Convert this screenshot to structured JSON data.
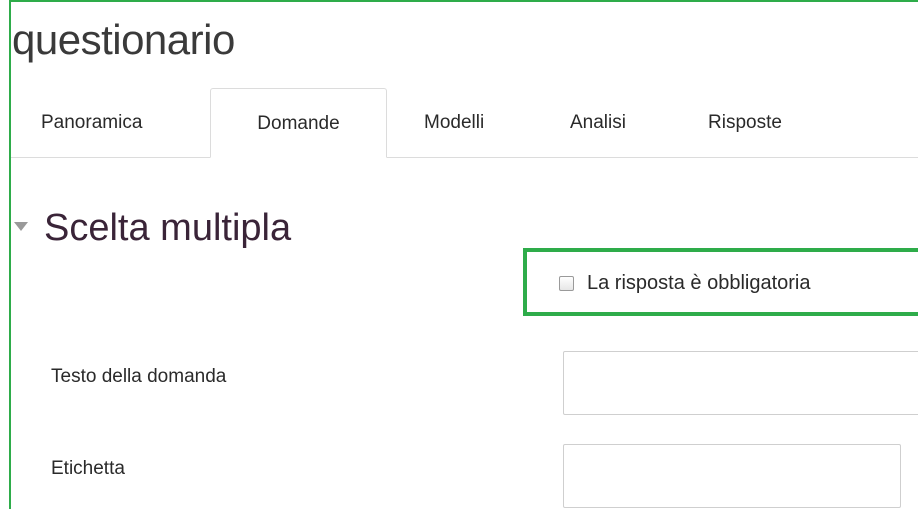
{
  "page": {
    "title": "questionario"
  },
  "tabs": [
    {
      "label": "Panoramica",
      "active": false
    },
    {
      "label": "Domande",
      "active": true
    },
    {
      "label": "Modelli",
      "active": false
    },
    {
      "label": "Analisi",
      "active": false
    },
    {
      "label": "Risposte",
      "active": false
    }
  ],
  "section": {
    "title": "Scelta multipla",
    "expanded": true,
    "toggle_icon": "caret-down-icon"
  },
  "required_checkbox": {
    "label": "La risposta è obbligatoria",
    "checked": false
  },
  "fields": {
    "question_text": {
      "label": "Testo della domanda",
      "value": ""
    },
    "tag": {
      "label": "Etichetta",
      "value": ""
    }
  },
  "colors": {
    "highlight": "#2eac4a",
    "section_title": "#3a2438",
    "tab_border": "#dcdcdc"
  }
}
